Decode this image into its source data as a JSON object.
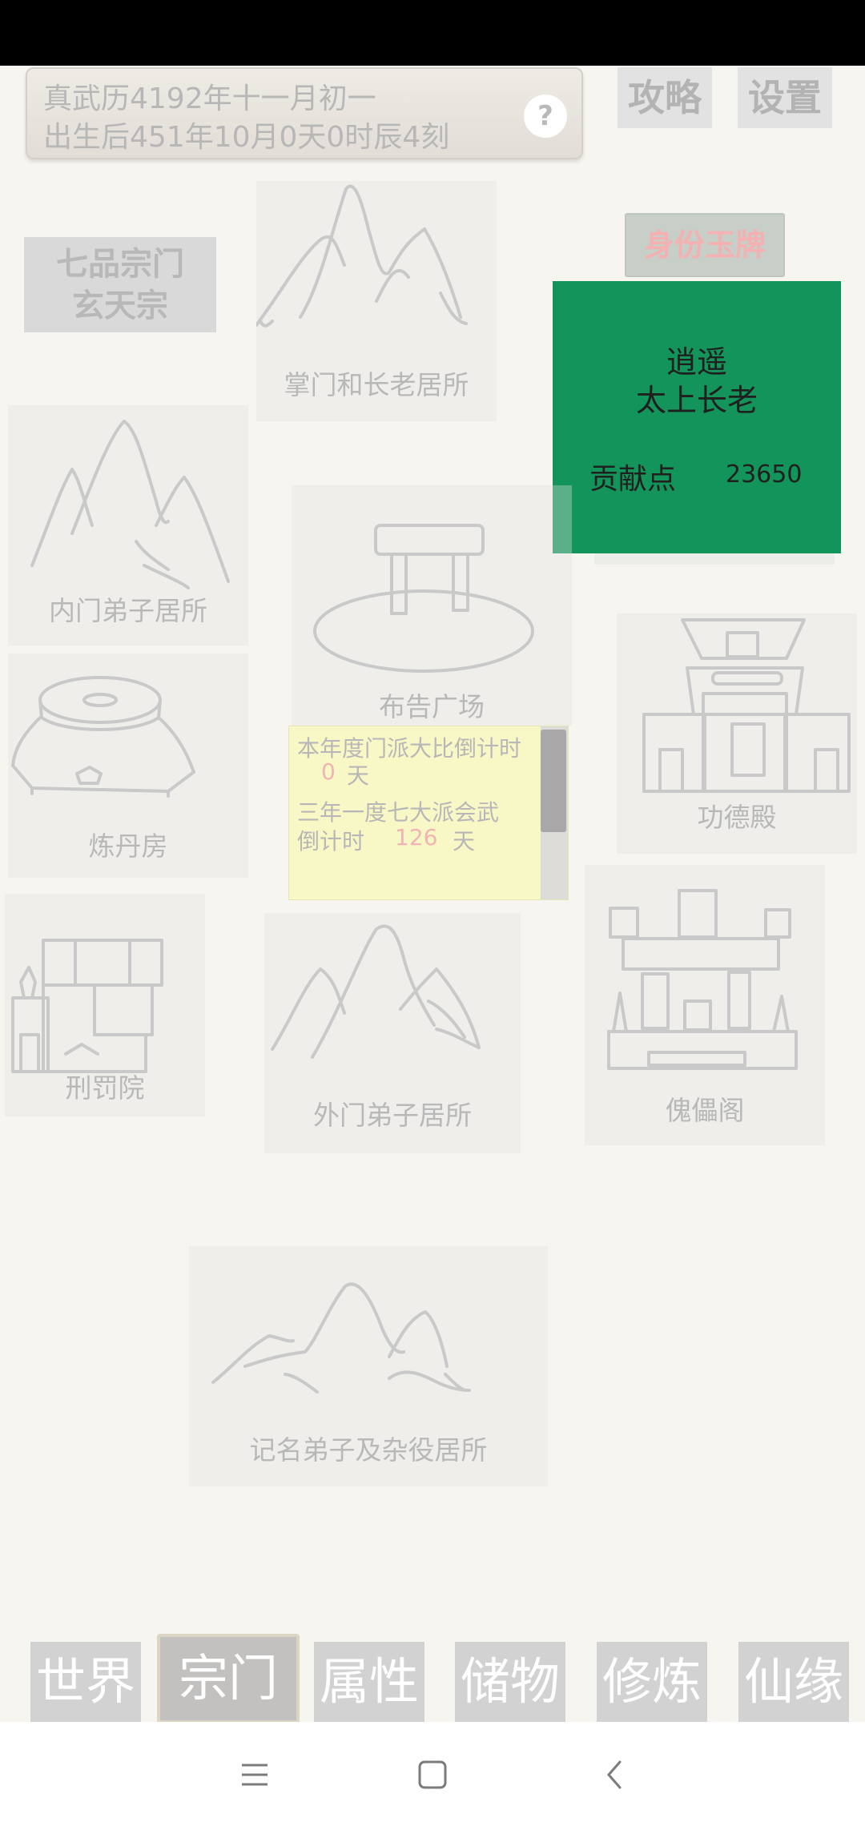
{
  "header": {
    "calendar_date": "真武历4192年十一月初一",
    "birth_time": "出生后451年10月0天0时辰4刻",
    "help_icon": "?",
    "guide_label": "攻略",
    "settings_label": "设置"
  },
  "sect": {
    "rank": "七品宗门",
    "name": "玄天宗"
  },
  "identity": {
    "jade_button_label": "身份玉牌",
    "name": "逍遥",
    "title": "太上长老",
    "contribution_label": "贡献点",
    "contribution_value": "23650",
    "card_color": "#13945a"
  },
  "buildings": {
    "leaders": "掌门和长老居所",
    "inner": "内门弟子居所",
    "plaza": "布告广场",
    "merit": "功德殿",
    "alchemy": "炼丹房",
    "punishment": "刑罚院",
    "outer": "外门弟子居所",
    "puppet": "傀儡阁",
    "registered": "记名弟子及杂役居所"
  },
  "notice": {
    "line1": "本年度门派大比倒计时",
    "days1": "0",
    "unit": "天",
    "line2": "三年一度七大派会武",
    "line3": "倒计时",
    "days2": "126",
    "countdown_color": "#f0b4b4"
  },
  "nav": {
    "tabs": [
      "世界",
      "宗门",
      "属性",
      "储物",
      "修炼",
      "仙缘"
    ],
    "active": "宗门"
  },
  "system_nav": [
    "menu-icon",
    "home-icon",
    "back-icon"
  ]
}
